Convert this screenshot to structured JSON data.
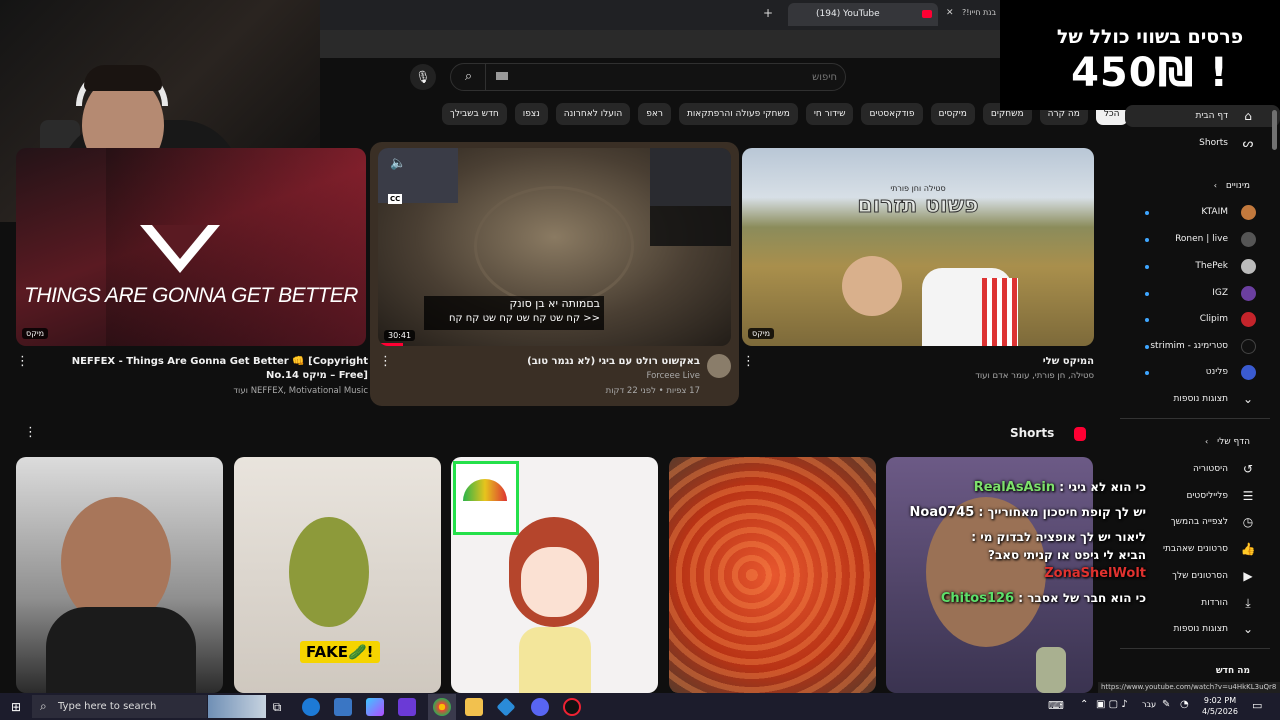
{
  "browser": {
    "tab_title": "(194) YouTube",
    "other_tab_title": "בנת חייו!?",
    "new_tab_symbol": "+"
  },
  "search": {
    "placeholder": "חיפוש"
  },
  "chips": [
    "הכל",
    "מה קרה",
    "משחקים",
    "מיקסים",
    "פודקאסטים",
    "שידור חי",
    "משחקי פעולה והרפתקאות",
    "ראפ",
    "הועלו לאחרונה",
    "נצפו",
    "חדש בשבילך"
  ],
  "sidebar": {
    "home": "דף הבית",
    "shorts": "Shorts",
    "subscriptions_header": "מינויים",
    "channels": [
      "KTAIM",
      "Ronen | live",
      "ThePek",
      "IGZ",
      "Clipim",
      "סטרימינג - strimim",
      "פלינט"
    ],
    "more1": "תצוגות נוספות",
    "you_header": "הדף שלי",
    "you_items": [
      "היסטוריה",
      "פלייליסטים",
      "לצפייה בהמשך",
      "סרטונים שאהבתי",
      "הסרטונים שלך",
      "הורדות"
    ],
    "more2": "תצוגות נוספות",
    "whats_new": "מה חדש"
  },
  "ad": {
    "line1": "פרסים בשווי כולל של",
    "line2": "450₪ !"
  },
  "webcam_overlay": {
    "song_text": "THINGS ARE GONNA GET BETTER"
  },
  "videos": [
    {
      "title": "NEFFEX - Things Are Gonna Get Better 👊 [Copyright Free] – מיקס No.14",
      "meta": "NEFFEX, Motivational Music ועוד",
      "badge": "מיקס"
    },
    {
      "title": "באקשוט רולט עם ביגי (לא נגמר טוב)",
      "channel": "Forceee Live",
      "stats": "17 צפיות • לפני 22 דקות",
      "duration": "30:41",
      "overlay_line1": "בםמותה יא בן סונק",
      "overlay_line2": "<< קח שט קח שט קח שט קח קח",
      "cc": "CC"
    },
    {
      "title": "המיקס שלי",
      "meta": "סטילה, חן פורתי, עומר אדם ועוד",
      "badge": "מיקס",
      "thumb_text1": "סטילה וחן פורתי",
      "thumb_text2": "פשוט תזרום"
    }
  ],
  "shorts_section": {
    "title": "Shorts",
    "short2_label": "FAKE🥒!"
  },
  "chat": [
    {
      "name": "RealAsAsin",
      "message": "כי הוא לא גיגי :"
    },
    {
      "name": "Noa0745",
      "message": "יש לך קופת חיסכון מאחורייך :"
    },
    {
      "name": "ZonaShelWolt",
      "message": "ליאור יש לך אופציה לבדוק מי : הביא לי גיפט או קניתי סאב?"
    },
    {
      "name": "Chitos126",
      "message": "כי הוא חבר של אסבר :"
    }
  ],
  "status_url": "https://www.youtube.com/watch?v=u4HkKL3uQr8",
  "taskbar": {
    "search_placeholder": "Type here to search",
    "lang": "עבר",
    "time": "9:02 PM",
    "date": "4/5/2026"
  },
  "colors": {
    "background": "#0f0f0f",
    "accent_red": "#ff0033",
    "chip_bg": "#272727",
    "link_blue": "#3ea6ff"
  }
}
